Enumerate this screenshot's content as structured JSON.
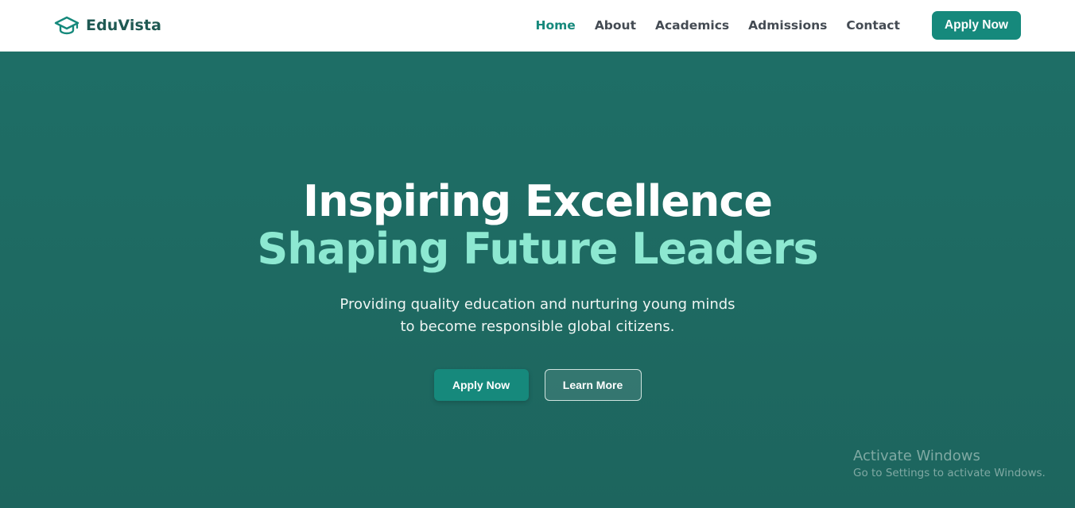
{
  "brand": {
    "name": "EduVista",
    "icon": "graduation-cap-icon",
    "color": "#1f5953"
  },
  "nav": {
    "links": [
      {
        "label": "Home",
        "active": true
      },
      {
        "label": "About",
        "active": false
      },
      {
        "label": "Academics",
        "active": false
      },
      {
        "label": "Admissions",
        "active": false
      },
      {
        "label": "Contact",
        "active": false
      }
    ],
    "cta_label": "Apply Now"
  },
  "hero": {
    "title_line1": "Inspiring Excellence",
    "title_line2": "Shaping Future Leaders",
    "subtitle_line1": "Providing quality education and nurturing young minds",
    "subtitle_line2": "to become responsible global citizens.",
    "primary_button": "Apply Now",
    "secondary_button": "Learn More"
  },
  "watermark": {
    "title": "Activate Windows",
    "subtitle": "Go to Settings to activate Windows."
  },
  "colors": {
    "accent": "#16897c",
    "hero_background": "#1e6b63",
    "highlight_text": "#8de8d1"
  }
}
